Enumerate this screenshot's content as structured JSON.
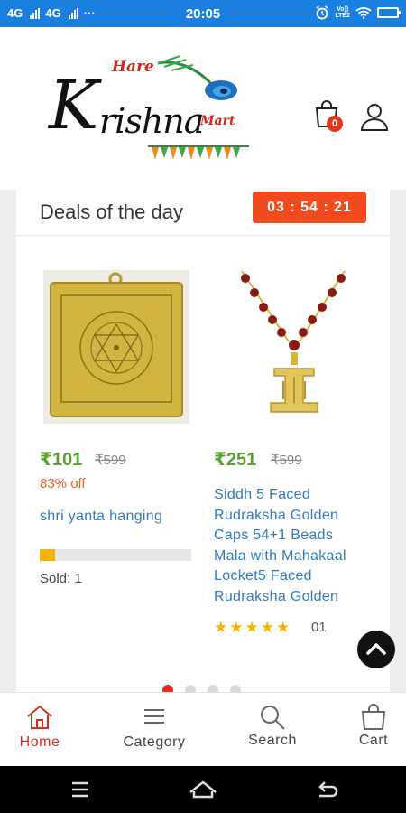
{
  "status_bar": {
    "net1": "4G",
    "net2": "4G",
    "more": "···",
    "time": "20:05",
    "lte_top": "Vo))",
    "lte_bottom": "LTE2"
  },
  "header": {
    "logo_hare": "Hare",
    "logo_k": "K",
    "logo_rishna": "rishna",
    "logo_mart": "Mart",
    "cart_count": "0"
  },
  "deals": {
    "title": "Deals of the day",
    "timer": "03 : 54 : 21"
  },
  "products": [
    {
      "price": "₹101",
      "mrp": "₹599",
      "discount": "83% off",
      "name": "shri yanta hanging",
      "sold_label": "Sold: 1",
      "sold_fraction": 0.1
    },
    {
      "price": "₹251",
      "mrp": "₹599",
      "name_lines": [
        "Siddh 5 Faced",
        "Rudraksha Golden",
        "Caps 54+1 Beads",
        "Mala with Mahakaal",
        "Locket5 Faced",
        "Rudraksha Golden"
      ],
      "stars": "★★★★★",
      "rating": 5,
      "rating_count": "01"
    }
  ],
  "carousel": {
    "dots": 4,
    "active": 0
  },
  "bottom_nav": {
    "home": "Home",
    "category": "Category",
    "search": "Search",
    "cart": "Cart"
  },
  "colors": {
    "status_bar": "#1b7fe0",
    "accent": "#ef4b1f",
    "price_green": "#57a229",
    "link_blue": "#2e7cc0",
    "star": "#f5b400"
  }
}
